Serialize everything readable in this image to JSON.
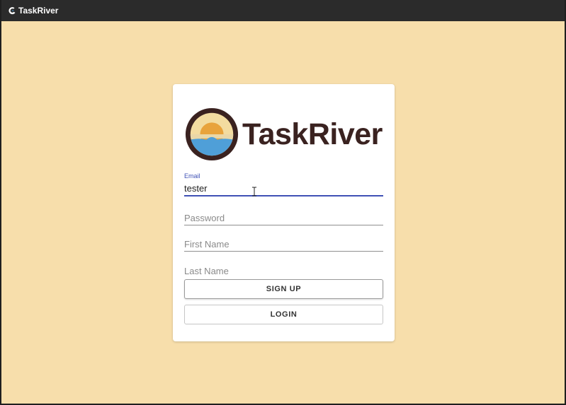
{
  "app": {
    "title": "TaskRiver",
    "icon": "wave-icon"
  },
  "logo": {
    "text": "TaskRiver",
    "icon": "sunset-water-logo-icon",
    "colors": {
      "ring": "#3a2220",
      "sun": "#e8a33c",
      "sky": "#f3dca0",
      "water": "#4f9fd8"
    }
  },
  "form": {
    "email": {
      "label": "Email",
      "value": "tester"
    },
    "password": {
      "placeholder": "Password"
    },
    "first_name": {
      "placeholder": "First Name"
    },
    "last_name": {
      "placeholder": "Last Name"
    },
    "signup_label": "SIGN UP",
    "login_label": "LOGIN"
  },
  "colors": {
    "background": "#f7deab",
    "appbar": "#2b2b2b",
    "accent": "#3f51b5"
  }
}
